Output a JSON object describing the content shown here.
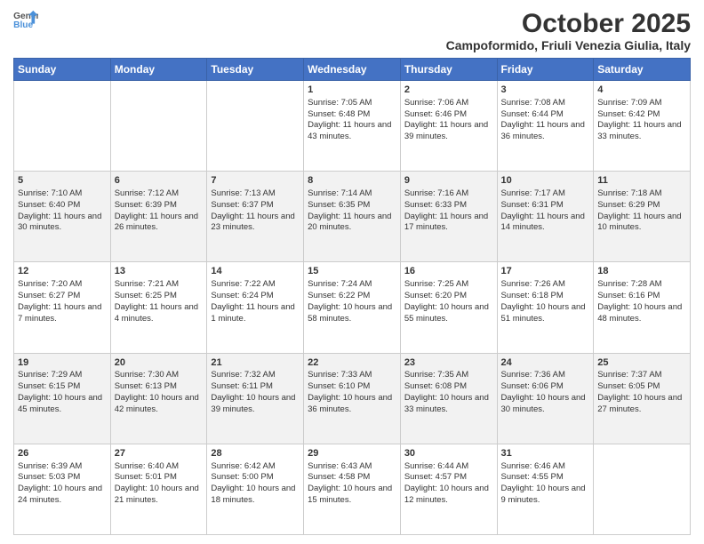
{
  "header": {
    "logo_line1": "General",
    "logo_line2": "Blue",
    "month": "October 2025",
    "location": "Campoformido, Friuli Venezia Giulia, Italy"
  },
  "days_of_week": [
    "Sunday",
    "Monday",
    "Tuesday",
    "Wednesday",
    "Thursday",
    "Friday",
    "Saturday"
  ],
  "weeks": [
    [
      {
        "day": "",
        "sunrise": "",
        "sunset": "",
        "daylight": ""
      },
      {
        "day": "",
        "sunrise": "",
        "sunset": "",
        "daylight": ""
      },
      {
        "day": "",
        "sunrise": "",
        "sunset": "",
        "daylight": ""
      },
      {
        "day": "1",
        "sunrise": "Sunrise: 7:05 AM",
        "sunset": "Sunset: 6:48 PM",
        "daylight": "Daylight: 11 hours and 43 minutes."
      },
      {
        "day": "2",
        "sunrise": "Sunrise: 7:06 AM",
        "sunset": "Sunset: 6:46 PM",
        "daylight": "Daylight: 11 hours and 39 minutes."
      },
      {
        "day": "3",
        "sunrise": "Sunrise: 7:08 AM",
        "sunset": "Sunset: 6:44 PM",
        "daylight": "Daylight: 11 hours and 36 minutes."
      },
      {
        "day": "4",
        "sunrise": "Sunrise: 7:09 AM",
        "sunset": "Sunset: 6:42 PM",
        "daylight": "Daylight: 11 hours and 33 minutes."
      }
    ],
    [
      {
        "day": "5",
        "sunrise": "Sunrise: 7:10 AM",
        "sunset": "Sunset: 6:40 PM",
        "daylight": "Daylight: 11 hours and 30 minutes."
      },
      {
        "day": "6",
        "sunrise": "Sunrise: 7:12 AM",
        "sunset": "Sunset: 6:39 PM",
        "daylight": "Daylight: 11 hours and 26 minutes."
      },
      {
        "day": "7",
        "sunrise": "Sunrise: 7:13 AM",
        "sunset": "Sunset: 6:37 PM",
        "daylight": "Daylight: 11 hours and 23 minutes."
      },
      {
        "day": "8",
        "sunrise": "Sunrise: 7:14 AM",
        "sunset": "Sunset: 6:35 PM",
        "daylight": "Daylight: 11 hours and 20 minutes."
      },
      {
        "day": "9",
        "sunrise": "Sunrise: 7:16 AM",
        "sunset": "Sunset: 6:33 PM",
        "daylight": "Daylight: 11 hours and 17 minutes."
      },
      {
        "day": "10",
        "sunrise": "Sunrise: 7:17 AM",
        "sunset": "Sunset: 6:31 PM",
        "daylight": "Daylight: 11 hours and 14 minutes."
      },
      {
        "day": "11",
        "sunrise": "Sunrise: 7:18 AM",
        "sunset": "Sunset: 6:29 PM",
        "daylight": "Daylight: 11 hours and 10 minutes."
      }
    ],
    [
      {
        "day": "12",
        "sunrise": "Sunrise: 7:20 AM",
        "sunset": "Sunset: 6:27 PM",
        "daylight": "Daylight: 11 hours and 7 minutes."
      },
      {
        "day": "13",
        "sunrise": "Sunrise: 7:21 AM",
        "sunset": "Sunset: 6:25 PM",
        "daylight": "Daylight: 11 hours and 4 minutes."
      },
      {
        "day": "14",
        "sunrise": "Sunrise: 7:22 AM",
        "sunset": "Sunset: 6:24 PM",
        "daylight": "Daylight: 11 hours and 1 minute."
      },
      {
        "day": "15",
        "sunrise": "Sunrise: 7:24 AM",
        "sunset": "Sunset: 6:22 PM",
        "daylight": "Daylight: 10 hours and 58 minutes."
      },
      {
        "day": "16",
        "sunrise": "Sunrise: 7:25 AM",
        "sunset": "Sunset: 6:20 PM",
        "daylight": "Daylight: 10 hours and 55 minutes."
      },
      {
        "day": "17",
        "sunrise": "Sunrise: 7:26 AM",
        "sunset": "Sunset: 6:18 PM",
        "daylight": "Daylight: 10 hours and 51 minutes."
      },
      {
        "day": "18",
        "sunrise": "Sunrise: 7:28 AM",
        "sunset": "Sunset: 6:16 PM",
        "daylight": "Daylight: 10 hours and 48 minutes."
      }
    ],
    [
      {
        "day": "19",
        "sunrise": "Sunrise: 7:29 AM",
        "sunset": "Sunset: 6:15 PM",
        "daylight": "Daylight: 10 hours and 45 minutes."
      },
      {
        "day": "20",
        "sunrise": "Sunrise: 7:30 AM",
        "sunset": "Sunset: 6:13 PM",
        "daylight": "Daylight: 10 hours and 42 minutes."
      },
      {
        "day": "21",
        "sunrise": "Sunrise: 7:32 AM",
        "sunset": "Sunset: 6:11 PM",
        "daylight": "Daylight: 10 hours and 39 minutes."
      },
      {
        "day": "22",
        "sunrise": "Sunrise: 7:33 AM",
        "sunset": "Sunset: 6:10 PM",
        "daylight": "Daylight: 10 hours and 36 minutes."
      },
      {
        "day": "23",
        "sunrise": "Sunrise: 7:35 AM",
        "sunset": "Sunset: 6:08 PM",
        "daylight": "Daylight: 10 hours and 33 minutes."
      },
      {
        "day": "24",
        "sunrise": "Sunrise: 7:36 AM",
        "sunset": "Sunset: 6:06 PM",
        "daylight": "Daylight: 10 hours and 30 minutes."
      },
      {
        "day": "25",
        "sunrise": "Sunrise: 7:37 AM",
        "sunset": "Sunset: 6:05 PM",
        "daylight": "Daylight: 10 hours and 27 minutes."
      }
    ],
    [
      {
        "day": "26",
        "sunrise": "Sunrise: 6:39 AM",
        "sunset": "Sunset: 5:03 PM",
        "daylight": "Daylight: 10 hours and 24 minutes."
      },
      {
        "day": "27",
        "sunrise": "Sunrise: 6:40 AM",
        "sunset": "Sunset: 5:01 PM",
        "daylight": "Daylight: 10 hours and 21 minutes."
      },
      {
        "day": "28",
        "sunrise": "Sunrise: 6:42 AM",
        "sunset": "Sunset: 5:00 PM",
        "daylight": "Daylight: 10 hours and 18 minutes."
      },
      {
        "day": "29",
        "sunrise": "Sunrise: 6:43 AM",
        "sunset": "Sunset: 4:58 PM",
        "daylight": "Daylight: 10 hours and 15 minutes."
      },
      {
        "day": "30",
        "sunrise": "Sunrise: 6:44 AM",
        "sunset": "Sunset: 4:57 PM",
        "daylight": "Daylight: 10 hours and 12 minutes."
      },
      {
        "day": "31",
        "sunrise": "Sunrise: 6:46 AM",
        "sunset": "Sunset: 4:55 PM",
        "daylight": "Daylight: 10 hours and 9 minutes."
      },
      {
        "day": "",
        "sunrise": "",
        "sunset": "",
        "daylight": ""
      }
    ]
  ]
}
